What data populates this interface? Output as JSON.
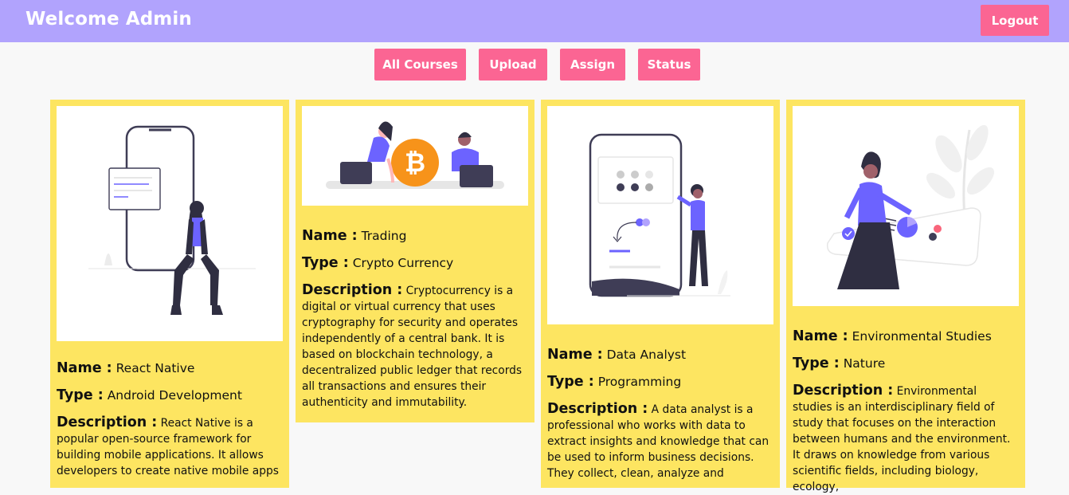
{
  "header": {
    "title": "Welcome Admin",
    "logout_label": "Logout"
  },
  "nav": [
    {
      "label": "All Courses"
    },
    {
      "label": "Upload"
    },
    {
      "label": "Assign"
    },
    {
      "label": "Status"
    }
  ],
  "field_labels": {
    "name": "Name :",
    "type": "Type :",
    "description": "Description :"
  },
  "courses": [
    {
      "name": "React Native",
      "type": "Android Development",
      "description": "React Native is a popular open-source framework for building mobile applications. It allows developers to create native mobile apps",
      "image_icon": "woman-sitting-by-phone-illustration"
    },
    {
      "name": "Trading",
      "type": "Crypto Currency",
      "description": "Cryptocurrency is a digital or virtual currency that uses cryptography for security and operates independently of a central bank. It is based on blockchain technology, a decentralized public ledger that records all transactions and ensures their authenticity and immutability.",
      "image_icon": "bitcoin-traders-illustration"
    },
    {
      "name": "Data Analyst",
      "type": "Programming",
      "description": "A data analyst is a professional who works with data to extract insights and knowledge that can be used to inform business decisions. They collect, clean, analyze and",
      "image_icon": "woman-with-phone-dashboard-illustration"
    },
    {
      "name": "Environmental Studies",
      "type": "Nature",
      "description": "Environmental studies is an interdisciplinary field of study that focuses on the interaction between humans and the environment. It draws on knowledge from various scientific fields, including biology, ecology,",
      "image_icon": "woman-with-chart-board-illustration"
    }
  ],
  "colors": {
    "header": "#b1a3fd",
    "button": "#fb6593",
    "card": "#fde561",
    "accent": "#6c63ff"
  }
}
